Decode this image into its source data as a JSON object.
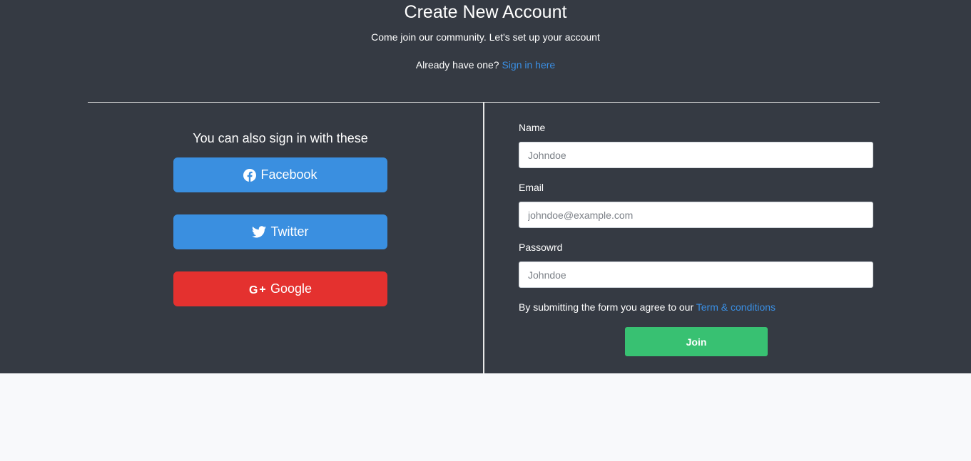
{
  "header": {
    "title": "Create New Account",
    "subtitle": "Come join our community. Let's set up your account",
    "signin_prompt": "Already have one?",
    "signin_link": "Sign in here"
  },
  "social": {
    "heading": "You can also sign in with these",
    "buttons": [
      {
        "label": "Facebook",
        "icon": "facebook-icon",
        "color": "#3a8fe0"
      },
      {
        "label": "Twitter",
        "icon": "twitter-icon",
        "color": "#3a8fe0"
      },
      {
        "label": "Google",
        "icon": "google-plus-icon",
        "color": "#e4312f"
      }
    ]
  },
  "form": {
    "name": {
      "label": "Name",
      "placeholder": "Johndoe",
      "value": ""
    },
    "email": {
      "label": "Email",
      "placeholder": "johndoe@example.com",
      "value": ""
    },
    "password": {
      "label": "Passowrd",
      "placeholder": "Johndoe",
      "value": ""
    },
    "terms_text": "By submitting the form you agree to our",
    "terms_link": "Term & conditions",
    "submit_label": "Join"
  },
  "colors": {
    "panel_background": "#353a43",
    "page_background": "#f8f9fb",
    "link": "#3a8fe4",
    "join_button": "#38c172"
  }
}
